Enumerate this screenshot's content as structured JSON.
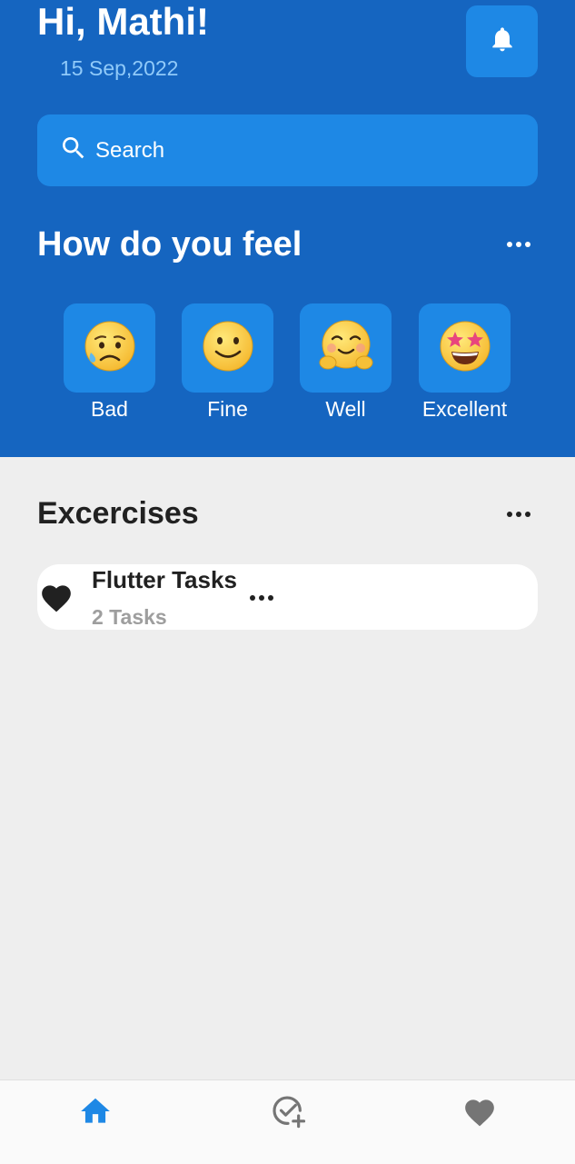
{
  "header": {
    "greeting": "Hi, Mathi!",
    "date": "15 Sep,2022",
    "search_placeholder": "Search",
    "feel_title": "How do you feel"
  },
  "moods": [
    {
      "emoji": "😥",
      "label": "Bad"
    },
    {
      "emoji": "🙂",
      "label": "Fine"
    },
    {
      "emoji": "🤗",
      "label": "Well"
    },
    {
      "emoji": "🤩",
      "label": "Excellent"
    }
  ],
  "exercises": {
    "title": "Excercises",
    "items": [
      {
        "title": "Flutter Tasks",
        "count": "2 Tasks"
      }
    ]
  },
  "bottom_nav": {
    "items": [
      {
        "icon": "home-icon",
        "active": true
      },
      {
        "icon": "task-add-icon",
        "active": false
      },
      {
        "icon": "heart-icon",
        "active": false
      }
    ]
  },
  "colors": {
    "header_bg": "#1565c0",
    "tile_bg": "#1e88e5",
    "page_bg": "#eeeeee",
    "nav_active": "#1e88e5",
    "nav_inactive": "#757575"
  }
}
